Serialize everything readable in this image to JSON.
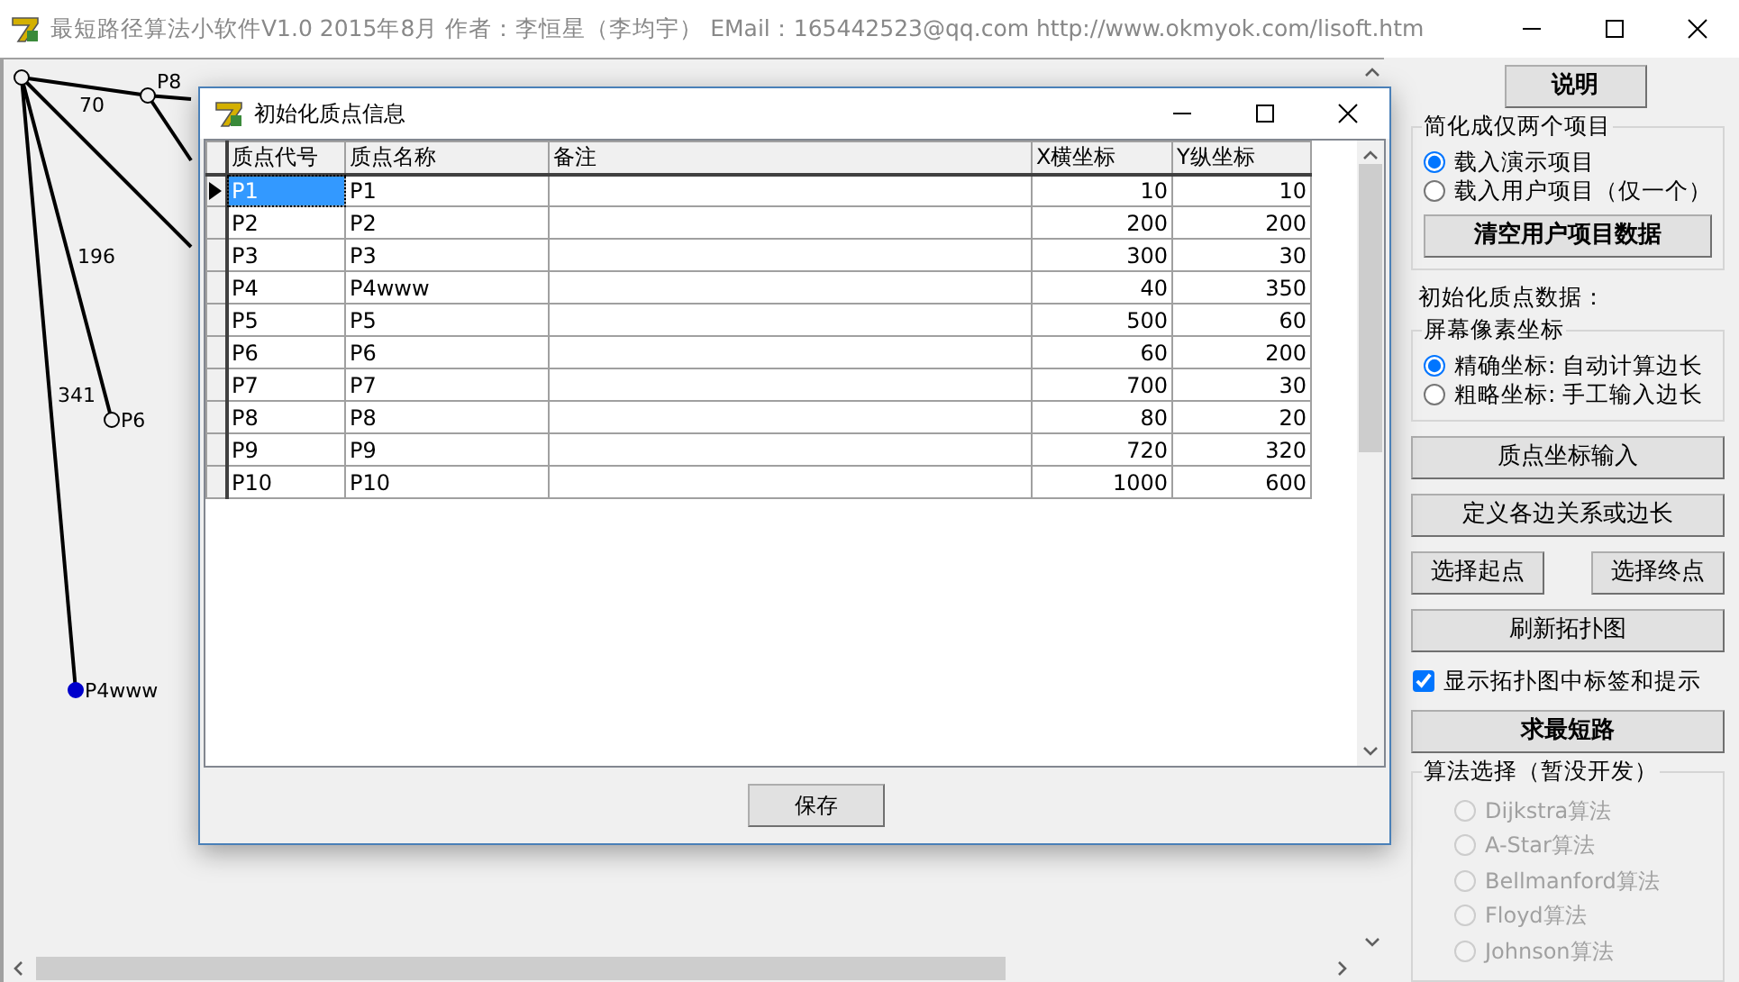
{
  "window": {
    "title": "最短路径算法小软件V1.0  2015年8月  作者：李恒星（李均宇）  EMail：165442523@qq.com   http://www.okmyok.com/lisoft.htm"
  },
  "graph": {
    "nodes": [
      {
        "label": "P8",
        "filled": false
      },
      {
        "label": "P6",
        "filled": false
      },
      {
        "label": "P4www",
        "filled": true
      }
    ],
    "edges": [
      {
        "label": "70"
      },
      {
        "label": "196"
      },
      {
        "label": "341"
      }
    ]
  },
  "dialog": {
    "title": "初始化质点信息",
    "columns": [
      "质点代号",
      "质点名称",
      "备注",
      "X横坐标",
      "Y纵坐标"
    ],
    "rows": [
      {
        "cells": [
          "P1",
          "P1",
          "",
          "10",
          "10"
        ],
        "current": true
      },
      {
        "cells": [
          "P2",
          "P2",
          "",
          "200",
          "200"
        ],
        "current": false
      },
      {
        "cells": [
          "P3",
          "P3",
          "",
          "300",
          "30"
        ],
        "current": false
      },
      {
        "cells": [
          "P4",
          "P4www",
          "",
          "40",
          "350"
        ],
        "current": false
      },
      {
        "cells": [
          "P5",
          "P5",
          "",
          "500",
          "60"
        ],
        "current": false
      },
      {
        "cells": [
          "P6",
          "P6",
          "",
          "60",
          "200"
        ],
        "current": false
      },
      {
        "cells": [
          "P7",
          "P7",
          "",
          "700",
          "30"
        ],
        "current": false
      },
      {
        "cells": [
          "P8",
          "P8",
          "",
          "80",
          "20"
        ],
        "current": false
      },
      {
        "cells": [
          "P9",
          "P9",
          "",
          "720",
          "320"
        ],
        "current": false
      },
      {
        "cells": [
          "P10",
          "P10",
          "",
          "1000",
          "600"
        ],
        "current": false
      }
    ],
    "save_button": "保存"
  },
  "panel": {
    "items": [
      {
        "kind": "button",
        "label": "说明",
        "bold": true,
        "narrow": true
      },
      {
        "kind": "group",
        "title": "简化成仅两个项目",
        "items": [
          {
            "kind": "radio",
            "label": "载入演示项目",
            "checked": true,
            "disabled": false
          },
          {
            "kind": "radio",
            "label": "载入用户项目（仅一个）",
            "checked": false,
            "disabled": false
          },
          {
            "kind": "button",
            "label": "清空用户项目数据",
            "bold": true,
            "narrow": false
          }
        ]
      },
      {
        "kind": "label",
        "label": "初始化质点数据："
      },
      {
        "kind": "group",
        "title": "屏幕像素坐标",
        "items": [
          {
            "kind": "radio",
            "label": "精确坐标: 自动计算边长",
            "checked": true,
            "disabled": false
          },
          {
            "kind": "radio",
            "label": "粗略坐标: 手工输入边长",
            "checked": false,
            "disabled": false
          }
        ]
      },
      {
        "kind": "button",
        "label": "质点坐标输入",
        "bold": false,
        "narrow": false
      },
      {
        "kind": "button",
        "label": "定义各边关系或边长",
        "bold": false,
        "narrow": false
      },
      {
        "kind": "pair",
        "buttons": [
          "选择起点",
          "选择终点"
        ]
      },
      {
        "kind": "button",
        "label": "刷新拓扑图",
        "bold": false,
        "narrow": false
      },
      {
        "kind": "checkbox",
        "label": "显示拓扑图中标签和提示",
        "checked": true
      },
      {
        "kind": "button",
        "label": "求最短路",
        "bold": true,
        "narrow": false
      },
      {
        "kind": "group",
        "title": "算法选择（暂没开发）",
        "items": [
          {
            "kind": "radio",
            "label": "Dijkstra算法",
            "checked": false,
            "disabled": true
          },
          {
            "kind": "radio",
            "label": "A-Star算法",
            "checked": false,
            "disabled": true
          },
          {
            "kind": "radio",
            "label": "Bellmanford算法",
            "checked": false,
            "disabled": true
          },
          {
            "kind": "radio",
            "label": "Floyd算法",
            "checked": false,
            "disabled": true
          },
          {
            "kind": "radio",
            "label": "Johnson算法",
            "checked": false,
            "disabled": true
          }
        ]
      }
    ]
  }
}
